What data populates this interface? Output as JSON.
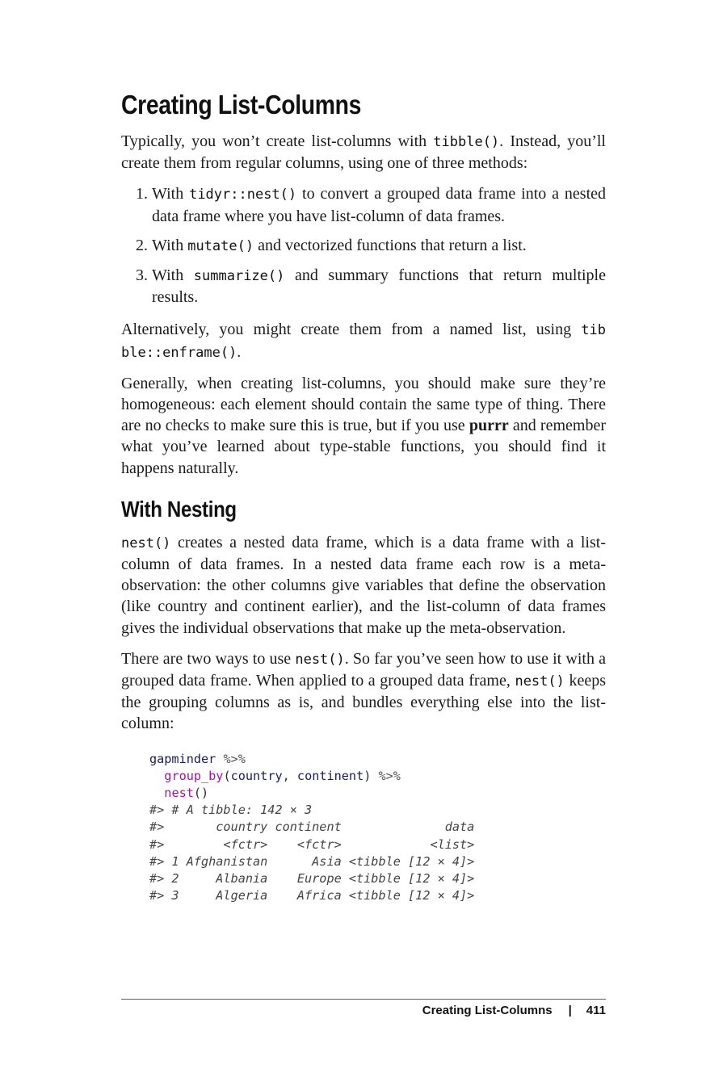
{
  "section_title": "Creating List-Columns",
  "intro": {
    "t1": "Typically, you won’t create list-columns with ",
    "c1": "tibble()",
    "t2": ". Instead, you’ll create them from regular columns, using one of three meth­ods:"
  },
  "methods": [
    {
      "t1": "With ",
      "code": "tidyr::nest()",
      "t2": " to convert a grouped data frame into a nested data frame where you have list-column of data frames."
    },
    {
      "t1": "With ",
      "code": "mutate()",
      "t2": " and vectorized functions that return a list."
    },
    {
      "t1": "With ",
      "code": "summarize()",
      "t2": " and summary functions that return multiple results."
    }
  ],
  "alt": {
    "t1": "Alternatively, you might create them from a named list, using ",
    "c1": "tib ble::enframe()",
    "t2": "."
  },
  "general": {
    "t1": "Generally, when creating list-columns, you should make sure they’re homogeneous: each element should contain the same type of thing. There are no checks to make sure this is true, but if you use ",
    "b1": "purrr",
    "t2": " and remember what you’ve learned about type-stable functions, you should find it happens naturally."
  },
  "subsection_title": "With Nesting",
  "nest_para": {
    "c1": "nest()",
    "t1": " creates a nested data frame, which is a data frame with a list-column of data frames. In a nested data frame each row is a meta-observation: the other columns give variables that define the observation (like country and continent earlier), and the list-column of data frames gives the individual observations that make up the meta-observation."
  },
  "two_ways": {
    "t1": "There are two ways to use ",
    "c1": "nest()",
    "t2": ". So far you’ve seen how to use it with a grouped data frame. When applied to a grouped data frame, ",
    "c2": "nest()",
    "t3": " keeps the grouping columns as is, and bundles everything else into the list-column:"
  },
  "code": {
    "l1_id": "gapminder",
    "pipe": " %>%",
    "l2_fn": "group_by",
    "l2_args_open": "(",
    "l2_arg1": "country",
    "l2_comma": ", ",
    "l2_arg2": "continent",
    "l2_args_close": ")",
    "l3_fn": "nest",
    "l3_parens": "()",
    "output": [
      "#> # A tibble: 142 × 3",
      "#>       country continent              data",
      "#>        <fctr>    <fctr>            <list>",
      "#> 1 Afghanistan      Asia <tibble [12 × 4]>",
      "#> 2     Albania    Europe <tibble [12 × 4]>",
      "#> 3     Algeria    Africa <tibble [12 × 4]>"
    ]
  },
  "footer": {
    "running_head": "Creating List-Columns",
    "separator": "|",
    "page_number": "411"
  }
}
